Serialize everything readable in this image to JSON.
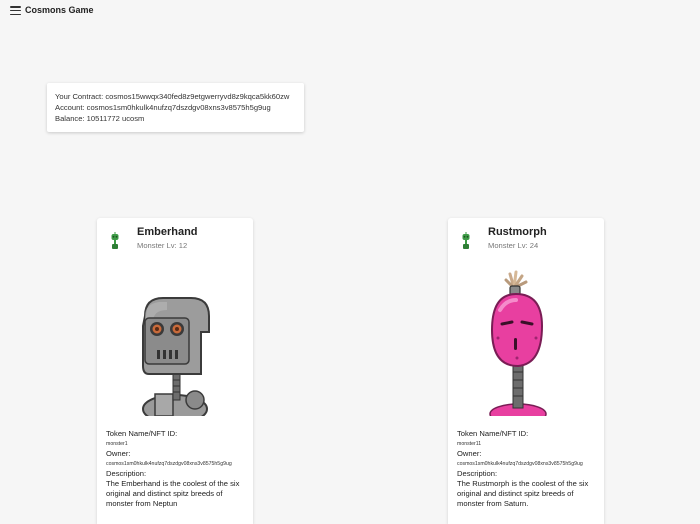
{
  "app": {
    "title": "Cosmons Game"
  },
  "info": {
    "contract": "Your Contract: cosmos15wwqx340fed8z9etgwerryvd8z9kqca5kk60zw",
    "account": "Account: cosmos1sm0hkulk4nufzq7dszdgv08xns3v8575h5g9ug",
    "balance": "Balance: 10511772 ucosm"
  },
  "cards": [
    {
      "name": "Emberhand",
      "level": "Monster Lv: 12",
      "token_label": "Token Name/NFT ID:",
      "token_id": "monster1",
      "owner_label": "Owner:",
      "owner": "cosmos1sm0hkulk4nufzq7dszdgv08xns3v8575h5g9ug",
      "description_label": "Description:",
      "description": "The Emberhand is the coolest of the six original and distinct spitz breeds of monster from Neptun"
    },
    {
      "name": "Rustmorph",
      "level": "Monster Lv: 24",
      "token_label": "Token Name/NFT ID:",
      "token_id": "monster11",
      "owner_label": "Owner:",
      "owner": "cosmos1sm0hkulk4nufzq7dszdgv08xns3v8575h5g9ug",
      "description_label": "Description:",
      "description": "The Rustmorph is the coolest of the six original and distinct spitz breeds of monster from Saturn."
    }
  ],
  "colors": {
    "robot_gray": "#8f8f8f",
    "robot_pink": "#e83fa0",
    "avatar_green": "#3d9b45"
  },
  "icons": {
    "menu": "hamburger-menu-icon",
    "avatar": "monster-avatar-icon"
  }
}
